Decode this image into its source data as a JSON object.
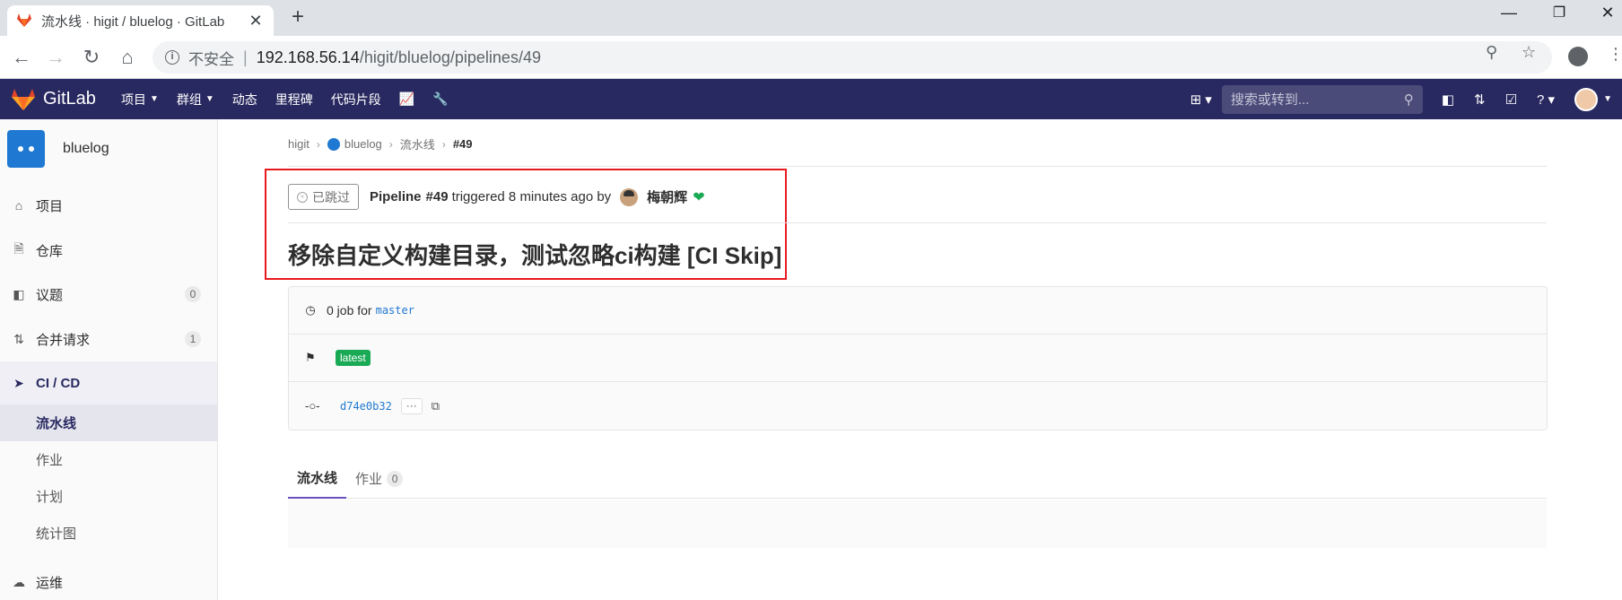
{
  "browser": {
    "tab_title": "流水线 · higit / bluelog · GitLab",
    "tab_close": "✕",
    "new_tab": "+",
    "insecure_label": "不安全",
    "url_host": "192.168.56.14",
    "url_path": "/higit/bluelog/pipelines/49"
  },
  "gitlab_nav": {
    "brand": "GitLab",
    "menu": [
      {
        "label": "项目"
      },
      {
        "label": "群组"
      },
      {
        "label": "动态"
      },
      {
        "label": "里程碑"
      },
      {
        "label": "代码片段"
      }
    ],
    "search_placeholder": "搜索或转到..."
  },
  "sidebar": {
    "project_name": "bluelog",
    "items": [
      {
        "label": "项目",
        "icon": "home-icon"
      },
      {
        "label": "仓库",
        "icon": "doc-icon"
      },
      {
        "label": "议题",
        "icon": "issues-icon",
        "count": "0"
      },
      {
        "label": "合并请求",
        "icon": "merge-request-icon",
        "count": "1"
      },
      {
        "label": "CI / CD",
        "icon": "rocket-icon"
      },
      {
        "label": "运维",
        "icon": "cloud-icon"
      }
    ],
    "cicd_sub": [
      "流水线",
      "作业",
      "计划",
      "统计图"
    ]
  },
  "breadcrumb": [
    "higit",
    "bluelog",
    "流水线",
    "#49"
  ],
  "pipeline": {
    "status": "已跳过",
    "label": "Pipeline",
    "id": "#49",
    "triggered_text": "triggered 8 minutes ago by",
    "user": "梅朝辉",
    "commit_title": "移除自定义构建目录，测试忽略ci构建 [CI Skip]",
    "jobs_text": "0 job for",
    "branch": "master",
    "tag_latest": "latest",
    "sha": "d74e0b32",
    "ellipsis": "···"
  },
  "tabs": [
    {
      "label": "流水线"
    },
    {
      "label": "作业",
      "count": "0"
    }
  ],
  "colors": {
    "nav_bg": "#292961",
    "highlight_box": "#e8191e",
    "latest_badge": "#1aaa55",
    "link": "#1f78d1"
  }
}
